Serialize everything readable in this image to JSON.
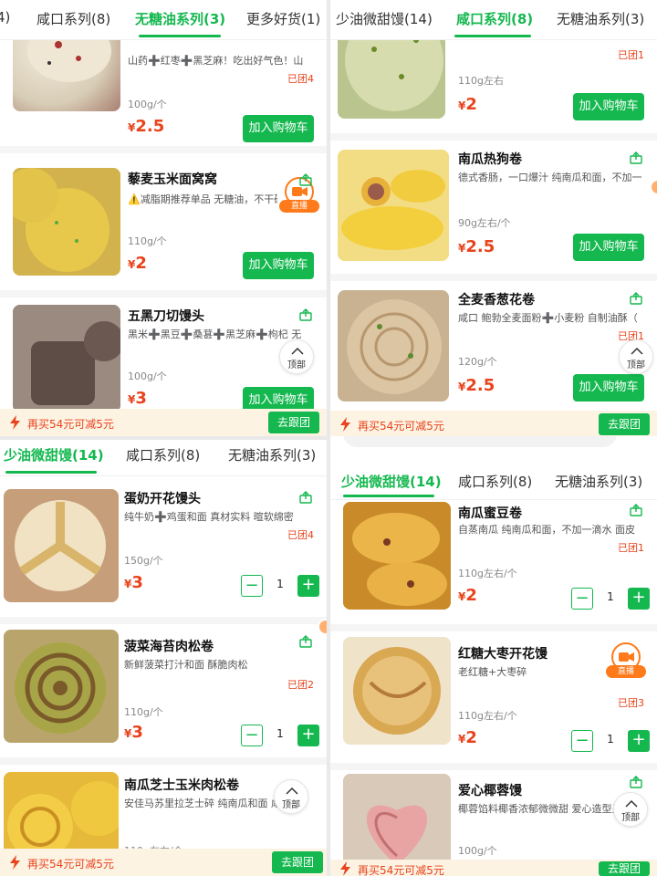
{
  "panels": [
    {
      "tabs": [
        {
          "label": "4)"
        },
        {
          "label": "咸口系列(8)"
        },
        {
          "label": "无糖油系列(3)",
          "active": true
        },
        {
          "label": "更多好货(1)"
        }
      ],
      "products": [
        {
          "name": "",
          "desc": "山药➕红枣➕黑芝麻！吃出好气色！山",
          "group": "已团4",
          "weight": "100g/个",
          "price": "2.5",
          "button": "加入购物车"
        },
        {
          "name": "藜麦玉米面窝窝",
          "desc": "⚠️减脂期推荐单品 无糖油，不干硬",
          "group": "",
          "weight": "110g/个",
          "price": "2",
          "button": "加入购物车",
          "live": "直播"
        },
        {
          "name": "五黑刀切馒头",
          "desc": "黑米➕黑豆➕桑葚➕黑芝麻➕枸杞 无",
          "group": "",
          "weight": "100g/个",
          "price": "3",
          "button": "加入购物车"
        }
      ],
      "top_label": "顶部",
      "promo": {
        "text": "再买54元可减5元",
        "button": "去跟团"
      }
    },
    {
      "tabs": [
        {
          "label": "少油微甜馒(14)"
        },
        {
          "label": "咸口系列(8)",
          "active": true
        },
        {
          "label": "无糖油系列(3)"
        }
      ],
      "products": [
        {
          "name": "",
          "desc": "",
          "group": "已团1",
          "weight": "110g左右",
          "price": "2",
          "button": "加入购物车"
        },
        {
          "name": "南瓜热狗卷",
          "desc": "德式香肠，一口爆汁 纯南瓜和面，不加一",
          "group": "",
          "weight": "90g左右/个",
          "price": "2.5",
          "button": "加入购物车"
        },
        {
          "name": "全麦香葱花卷",
          "desc": "咸口 鲍勃全麦面粉➕小麦粉 自制油酥（",
          "group": "已团1",
          "weight": "120g/个",
          "price": "2.5",
          "button": "加入购物车"
        }
      ],
      "top_label": "顶部",
      "promo": {
        "text": "再买54元可减5元",
        "button": "去跟团"
      }
    },
    {
      "tabs": [
        {
          "label": "少油微甜馒(14)",
          "active": true
        },
        {
          "label": "咸口系列(8)"
        },
        {
          "label": "无糖油系列(3)"
        }
      ],
      "products": [
        {
          "name": "蛋奶开花馒头",
          "desc": "纯牛奶➕鸡蛋和面 真材实料 暄软绵密",
          "group": "已团4",
          "weight": "150g/个",
          "price": "3",
          "qty": "1"
        },
        {
          "name": "菠菜海苔肉松卷",
          "desc": "新鲜菠菜打汁和面 酥脆肉松",
          "group": "已团2",
          "weight": "110g/个",
          "price": "3",
          "qty": "1"
        },
        {
          "name": "南瓜芝士玉米肉松卷",
          "desc": "安佳马苏里拉芝士碎 纯南瓜和面 咸",
          "group": "",
          "weight": "110g左右/个",
          "price": "",
          "qty": ""
        }
      ],
      "top_label": "顶部",
      "promo": {
        "text": "再买54元可减5元",
        "button": "去跟团"
      }
    },
    {
      "tabs": [
        {
          "label": "少油微甜馒(14)",
          "active": true
        },
        {
          "label": "咸口系列(8)"
        },
        {
          "label": "无糖油系列(3)"
        }
      ],
      "products": [
        {
          "name": "南瓜蜜豆卷",
          "desc": "自蒸南瓜 纯南瓜和面，不加一滴水 面皮",
          "group": "已团1",
          "weight": "110g左右/个",
          "price": "2",
          "qty": "1"
        },
        {
          "name": "红糖大枣开花馒",
          "desc": "老红糖+大枣碎",
          "group": "已团3",
          "weight": "110g左右/个",
          "price": "2",
          "qty": "1",
          "live": "直播"
        },
        {
          "name": "爱心椰蓉馒",
          "desc": "椰蓉馅料椰香浓郁微微甜 爱心造型呈",
          "group": "",
          "weight": "100g/个",
          "price": "",
          "qty": ""
        }
      ],
      "top_label": "顶部",
      "promo": {
        "text": "再买54元可减5元",
        "button": "去跟团"
      }
    }
  ],
  "colors": {
    "accent": "#14b84f",
    "price": "#e8431c",
    "promo_bg": "#fdf3e3",
    "live": "#ff7a1a"
  }
}
